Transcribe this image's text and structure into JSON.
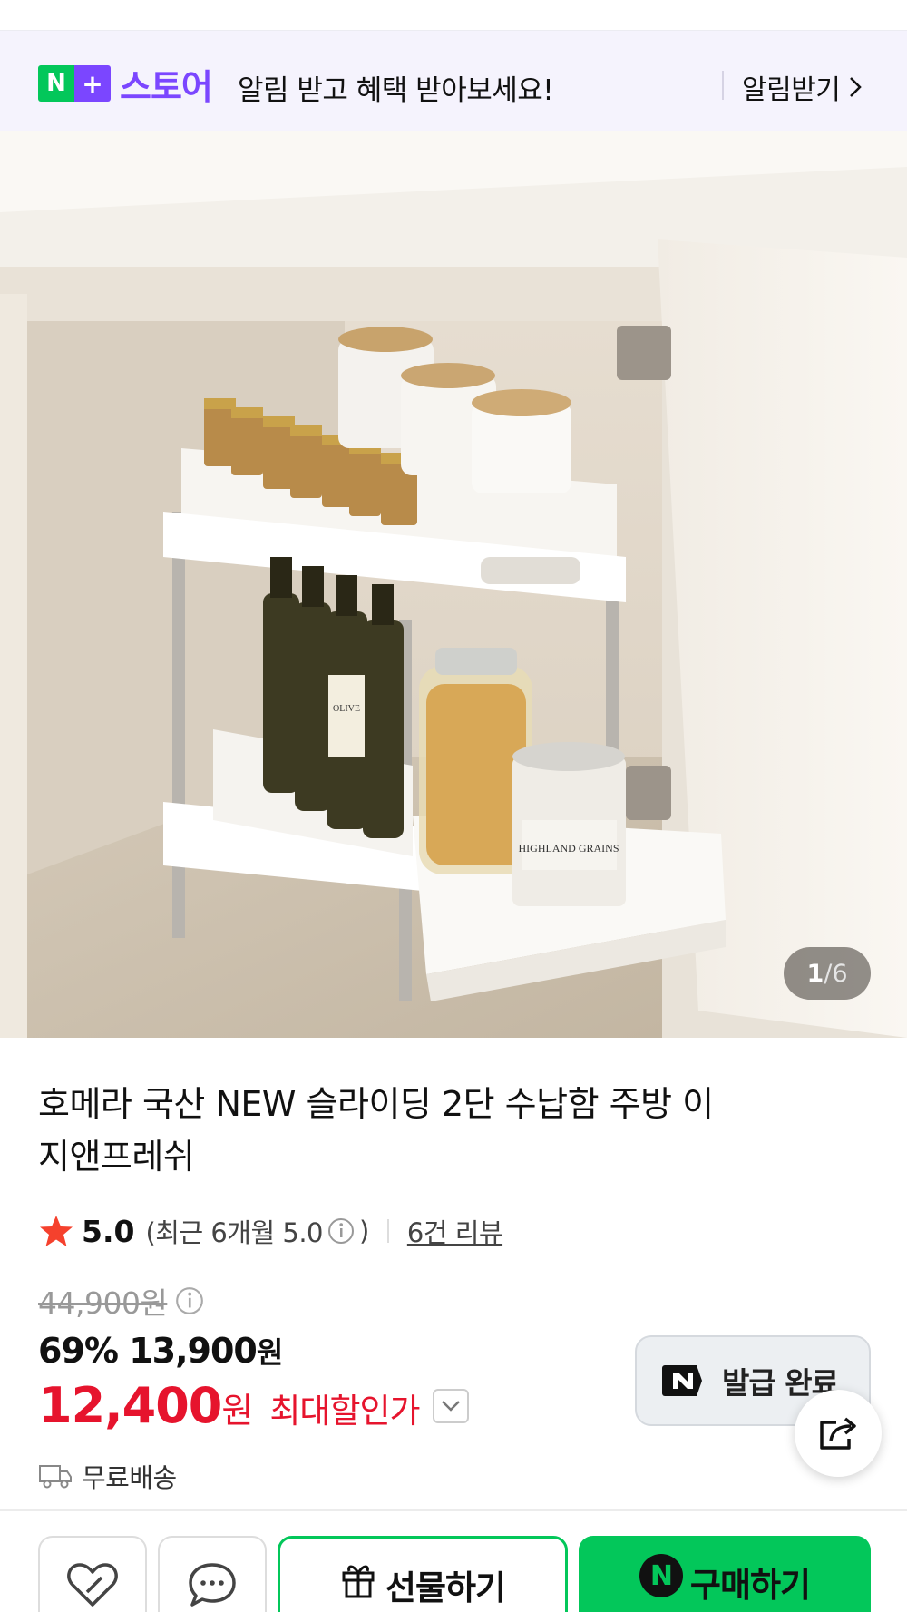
{
  "banner": {
    "logo_n": "N",
    "logo_plus": "+",
    "logo_store": "스토어",
    "message": "알림 받고 혜택 받아보세요!",
    "cta": "알림받기"
  },
  "gallery": {
    "current": "1",
    "separator": "/",
    "total": "6",
    "jar_label": "HIGHLAND GRAINS",
    "bottle_label": "OLIVE"
  },
  "product": {
    "title": "호메라 국산 NEW 슬라이딩 2단 수납함 주방 이지앤프레쉬",
    "rating": "5.0",
    "recent_rating": "(최근 6개월 5.0",
    "recent_close": ")",
    "reviews": "6건 리뷰",
    "original_price": "44,900원",
    "discount_rate": "69%",
    "sale_price": "13,900",
    "sale_won": "원",
    "best_price": "12,400",
    "best_won": "원",
    "best_label": "최대할인가",
    "coupon_label": "발급 완료",
    "shipping": "무료배송"
  },
  "bottom_bar": {
    "gift": "선물하기",
    "buy": "구매하기",
    "buy_n": "N"
  },
  "colors": {
    "naver_green": "#03c75a",
    "store_purple": "#7b46ff",
    "price_red": "#e6142d",
    "banner_bg": "#f5f3fd"
  }
}
